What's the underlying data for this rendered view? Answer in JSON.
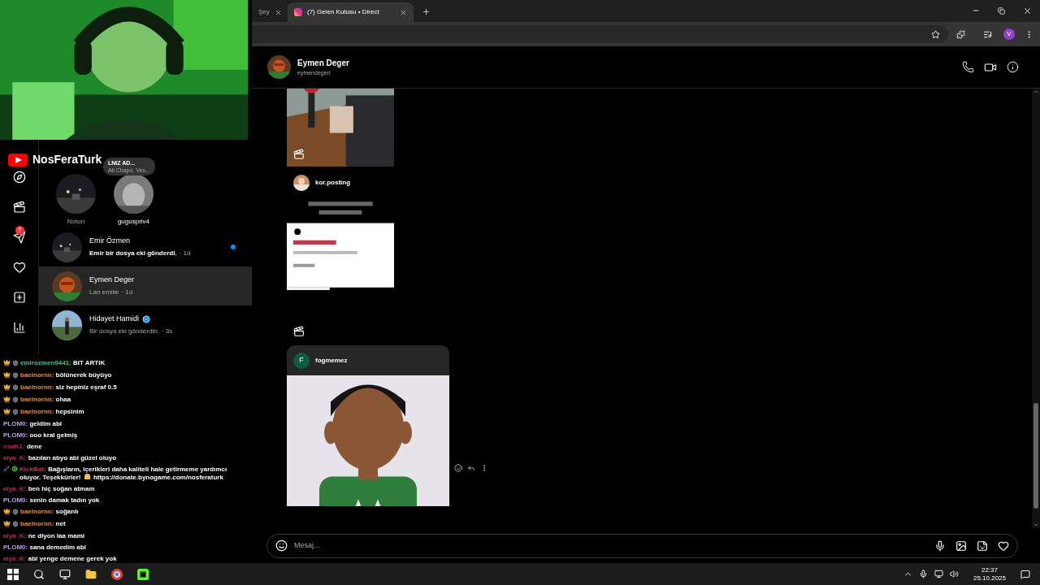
{
  "stream": {
    "channel": "NosFeraTurk"
  },
  "browser": {
    "tabs": [
      {
        "title": "Şey",
        "selected": false
      },
      {
        "title": "(7) Gelen Kutusu • Direct",
        "selected": true
      }
    ],
    "profile_initial": "V"
  },
  "instagram": {
    "messages_badge": "7",
    "notes": [
      {
        "name": "Notun"
      },
      {
        "name": "guguspriv4",
        "note": [
          "LNIZ AD...",
          "Ali Chapo, Ves..."
        ]
      }
    ],
    "conversations": [
      {
        "name": "Emir Özmen",
        "preview": "Emir bir dosya eki gönderdi.",
        "time": "· 1d",
        "unread": true,
        "selected": false,
        "verified": false
      },
      {
        "name": "Eymen Deger",
        "preview": "Lan emiiie",
        "time": "· 1d",
        "unread": false,
        "selected": true,
        "verified": false
      },
      {
        "name": "Hidayet Hamidi",
        "preview": "Bir dosya eki gönderdin.",
        "time": "· 3s",
        "unread": false,
        "selected": false,
        "verified": true
      }
    ],
    "chat_header": {
      "name": "Eymen Deger",
      "username": "eymendegerr"
    },
    "thread": {
      "reels": [
        {
          "sender": "kor.posting"
        },
        {
          "sender": "fogmemez",
          "initial": "F"
        }
      ]
    },
    "composer": {
      "placeholder": "Mesaj..."
    }
  },
  "chat_separator": ":",
  "stream_chat": [
    {
      "kind": "sub",
      "user": "emirozmen0441",
      "color": "#2fc7a0",
      "text": "BIT ARTIK"
    },
    {
      "kind": "sub",
      "user": "baelnornn",
      "color": "#e8892b",
      "text": "bölünerek büyüyo"
    },
    {
      "kind": "sub",
      "user": "baelnornn",
      "color": "#e8892b",
      "text": "siz hepiniz eşraf 0.5"
    },
    {
      "kind": "sub",
      "user": "baelnornn",
      "color": "#e8892b",
      "text": "ohaa"
    },
    {
      "kind": "sub",
      "user": "baelnornn",
      "color": "#e8892b",
      "text": "hepsinim"
    },
    {
      "kind": "plain",
      "user": "PLOM0",
      "color": "#b99cf0",
      "text": "geldim abi"
    },
    {
      "kind": "plain",
      "user": "PLOM0",
      "color": "#b99cf0",
      "text": "ooo kral gelmiş"
    },
    {
      "kind": "plain",
      "user": "nsaK1",
      "color": "#c2264f",
      "text": "dene"
    },
    {
      "kind": "plain",
      "user": "alya_K",
      "color": "#c2264f",
      "text": "bazıları atıyo abi güzel oluyo"
    },
    {
      "kind": "bot",
      "user": "KickBot",
      "color": "#d0304a",
      "text": "Bağışların, içerikleri daha kaliteli hale getirmeme yardımcı oluyor. Teşekkürler!",
      "link": "https://donate.bynogame.com/nosferaturk"
    },
    {
      "kind": "plain",
      "user": "alya_K",
      "color": "#c2264f",
      "text": "ben hiç soğan atmam"
    },
    {
      "kind": "plain",
      "user": "PLOM0",
      "color": "#b99cf0",
      "text": "senin damak tadın yok"
    },
    {
      "kind": "sub",
      "user": "baelnornn",
      "color": "#e8892b",
      "text": "soğanlı"
    },
    {
      "kind": "sub",
      "user": "baelnornn",
      "color": "#e8892b",
      "text": "net"
    },
    {
      "kind": "plain",
      "user": "alya_K",
      "color": "#c2264f",
      "text": "ne diyon laa mami"
    },
    {
      "kind": "plain",
      "user": "PLOM0",
      "color": "#b99cf0",
      "text": "sana demedim abi"
    },
    {
      "kind": "plain",
      "user": "alya_K",
      "color": "#c2264f",
      "text": "abi yenge demene gerek yok"
    }
  ],
  "taskbar": {
    "time": "22:37",
    "date": "25.10.2025"
  }
}
